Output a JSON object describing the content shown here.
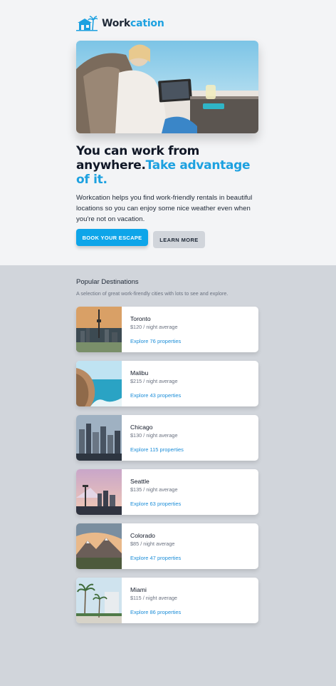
{
  "brand": {
    "part1": "Work",
    "part2": "cation",
    "accent_color": "#1da1e0"
  },
  "hero": {
    "headline_main": "You can work from anywhere.",
    "headline_accent": "Take advantage of it.",
    "intro": "Workcation helps you find work-friendly rentals in beautiful locations so you can enjoy some nice weather even when you're not on vacation.",
    "primary_button": "BOOK YOUR ESCAPE",
    "secondary_button": "LEARN MORE"
  },
  "destinations": {
    "title": "Popular Destinations",
    "subtitle": "A selection of great work-firendly cities with lots to see and explore.",
    "items": [
      {
        "city": "Toronto",
        "price": "$120 / night average",
        "link": "Explore 76 properties"
      },
      {
        "city": "Malibu",
        "price": "$215 / night average",
        "link": "Explore 43 properties"
      },
      {
        "city": "Chicago",
        "price": "$130 / night average",
        "link": "Explore 115 properties"
      },
      {
        "city": "Seattle",
        "price": "$135 / night average",
        "link": "Explore 63 properties"
      },
      {
        "city": "Colorado",
        "price": "$85 / night average",
        "link": "Explore 47 properties"
      },
      {
        "city": "Miami",
        "price": "$115 / night average",
        "link": "Explore 86 properties"
      }
    ]
  }
}
